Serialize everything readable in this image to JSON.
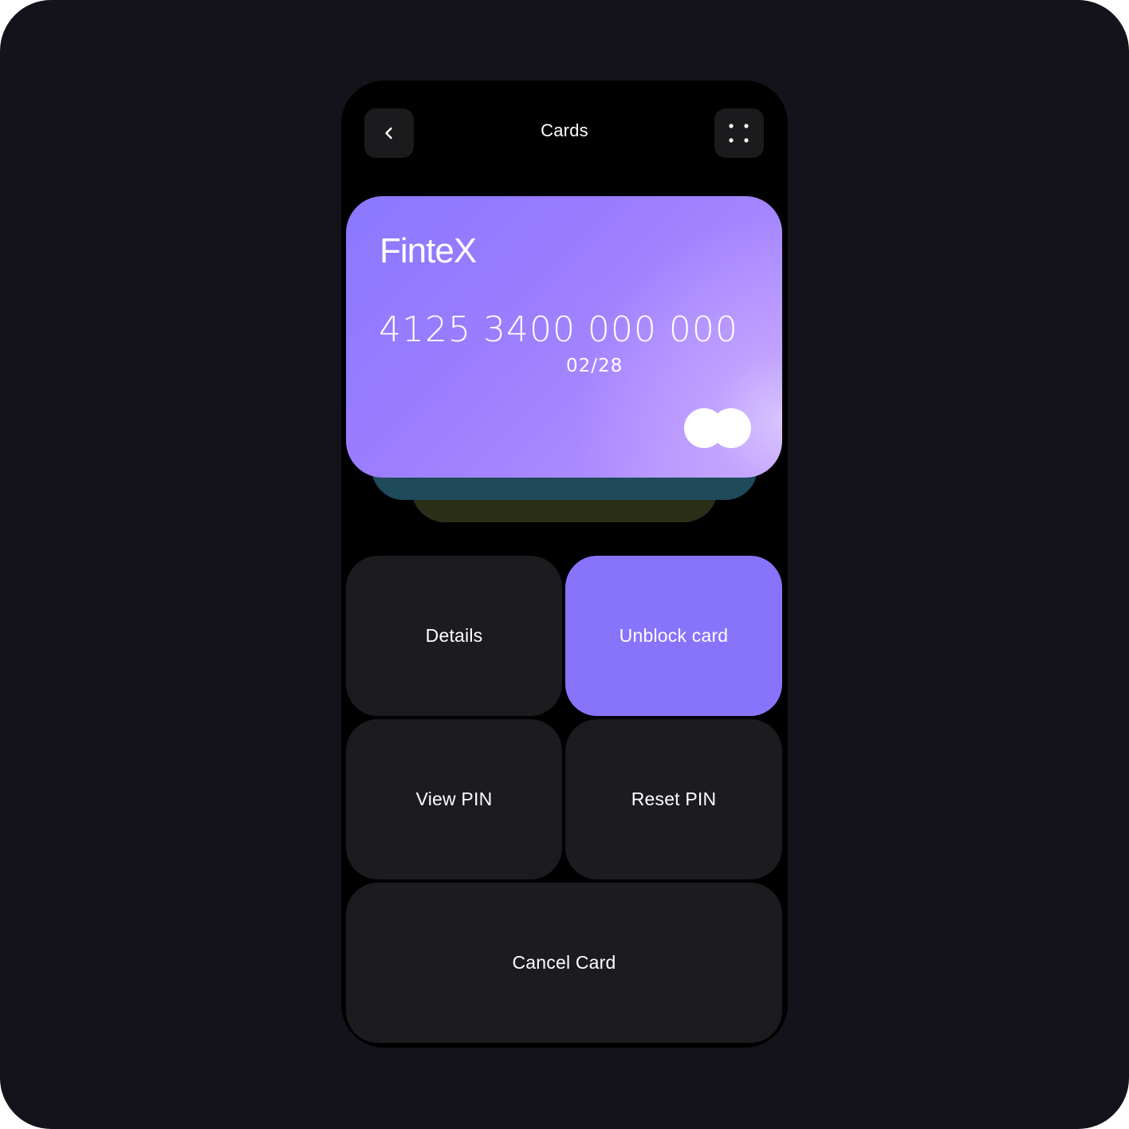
{
  "header": {
    "title": "Cards",
    "back_icon": "chevron-left-icon",
    "menu_icon": "grid-dots-icon"
  },
  "card": {
    "brand": "FinteX",
    "number": "4125 3400 000 000",
    "expiry": "02/28",
    "network_icon": "card-network-logo-icon",
    "gradient_colors": [
      "#8a78ff",
      "#bfa0ff",
      "#d9c4ff"
    ]
  },
  "stack_colors": [
    "#1f4a5a",
    "#2b2f18"
  ],
  "actions": {
    "details": "Details",
    "unblock": "Unblock card",
    "view_pin": "View PIN",
    "reset_pin": "Reset PIN",
    "cancel": "Cancel Card"
  },
  "colors": {
    "background": "#14121a",
    "accent": "#8874fb",
    "tile": "#1c1b1f"
  }
}
